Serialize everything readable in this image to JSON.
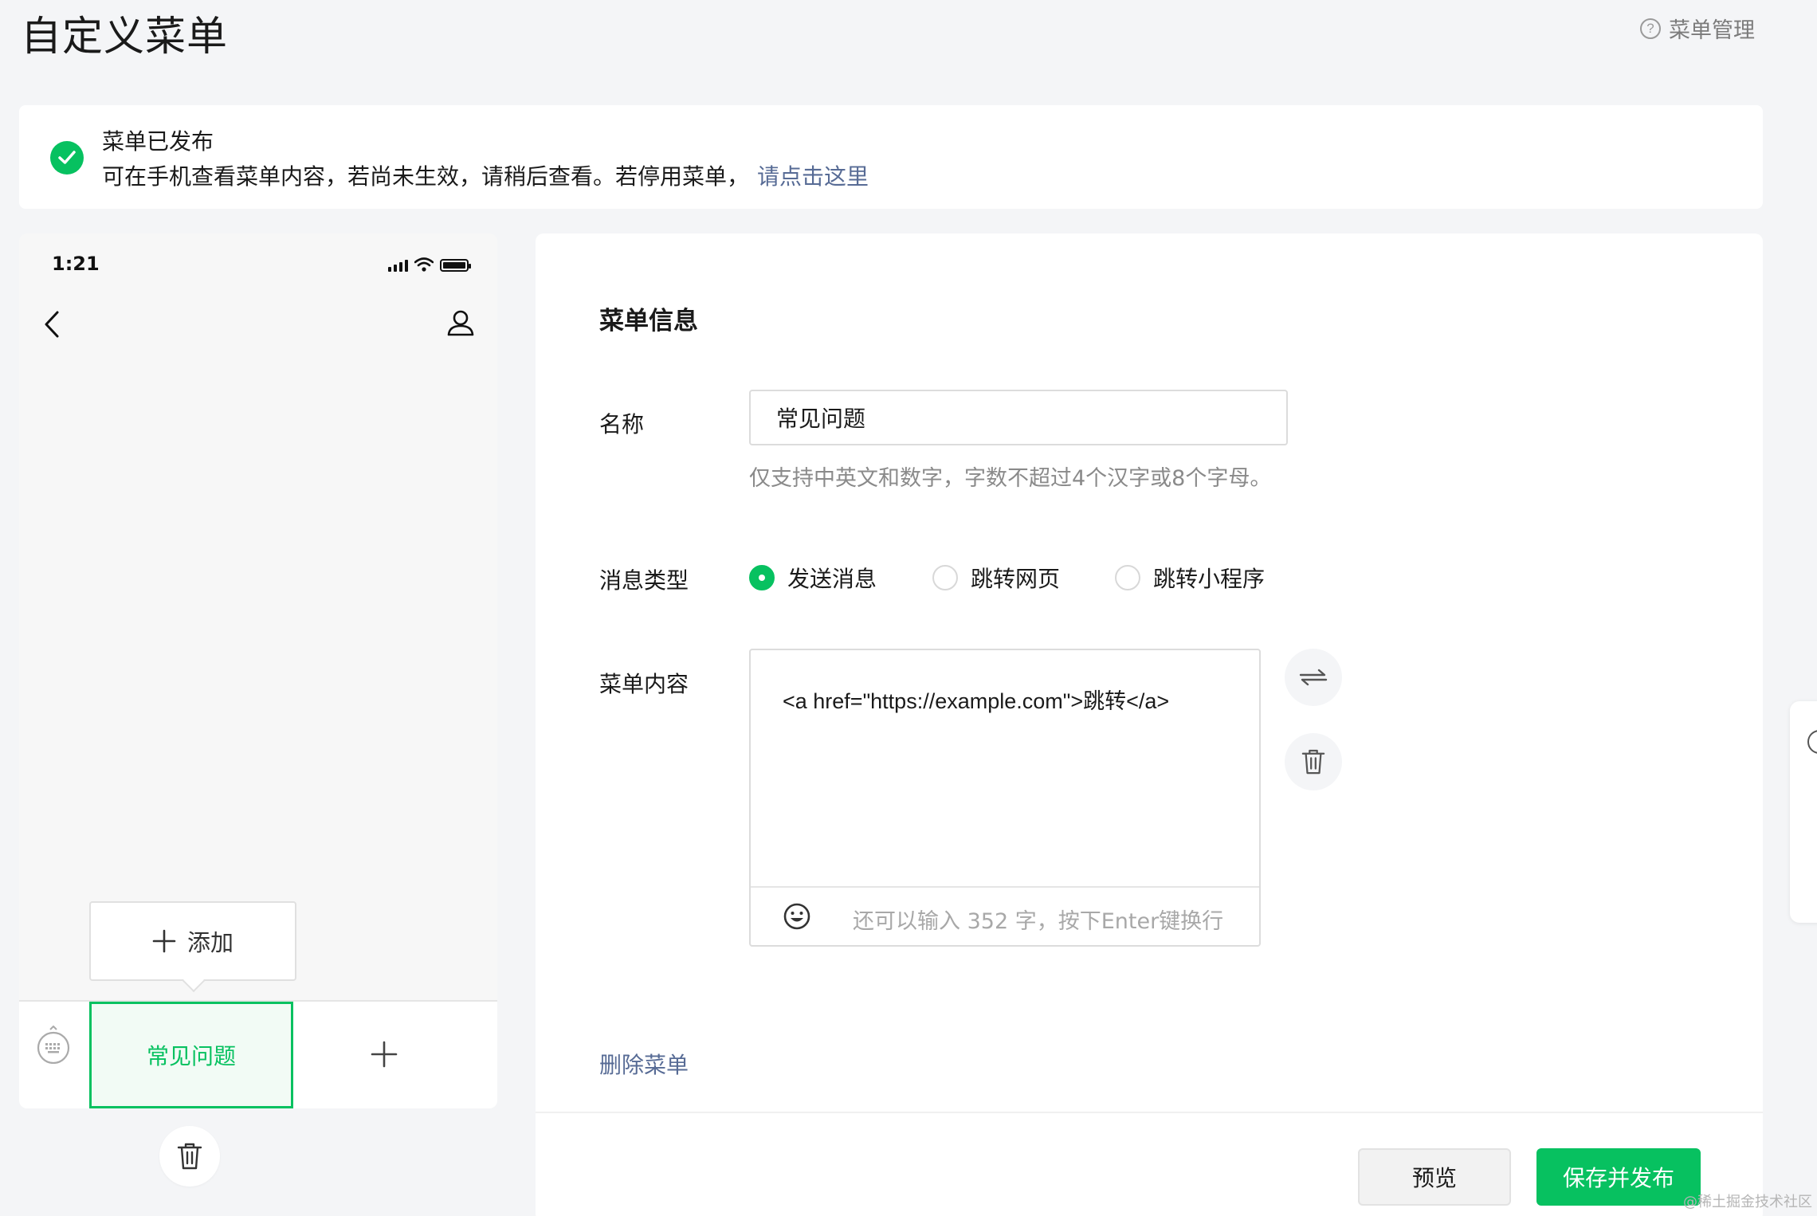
{
  "page": {
    "title": "自定义菜单",
    "help_label": "菜单管理"
  },
  "notice": {
    "title": "菜单已发布",
    "body": "可在手机查看菜单内容，若尚未生效，请稍后查看。若停用菜单，",
    "link": "请点击这里"
  },
  "phone": {
    "time": "1:21",
    "add_label": "添加",
    "menu_items": [
      "常见问题"
    ]
  },
  "panel": {
    "title": "菜单信息",
    "name_label": "名称",
    "name_value": "常见问题",
    "name_hint": "仅支持中英文和数字，字数不超过4个汉字或8个字母。",
    "type_label": "消息类型",
    "type_options": [
      "发送消息",
      "跳转网页",
      "跳转小程序"
    ],
    "type_selected": "发送消息",
    "content_label": "菜单内容",
    "content_value": "<a href=\"https://example.com\">跳转</a>",
    "content_count": "还可以输入 352 字，按下Enter键换行",
    "delete_label": "删除菜单",
    "preview_label": "预览",
    "publish_label": "保存并发布"
  },
  "watermark": "@稀土掘金技术社区",
  "colors": {
    "accent": "#07c160",
    "link": "#576b95"
  },
  "icons": [
    "help-icon",
    "check-icon",
    "back-icon",
    "user-icon",
    "plus-icon",
    "keyboard-icon",
    "trash-icon",
    "swap-icon",
    "emoji-icon"
  ]
}
